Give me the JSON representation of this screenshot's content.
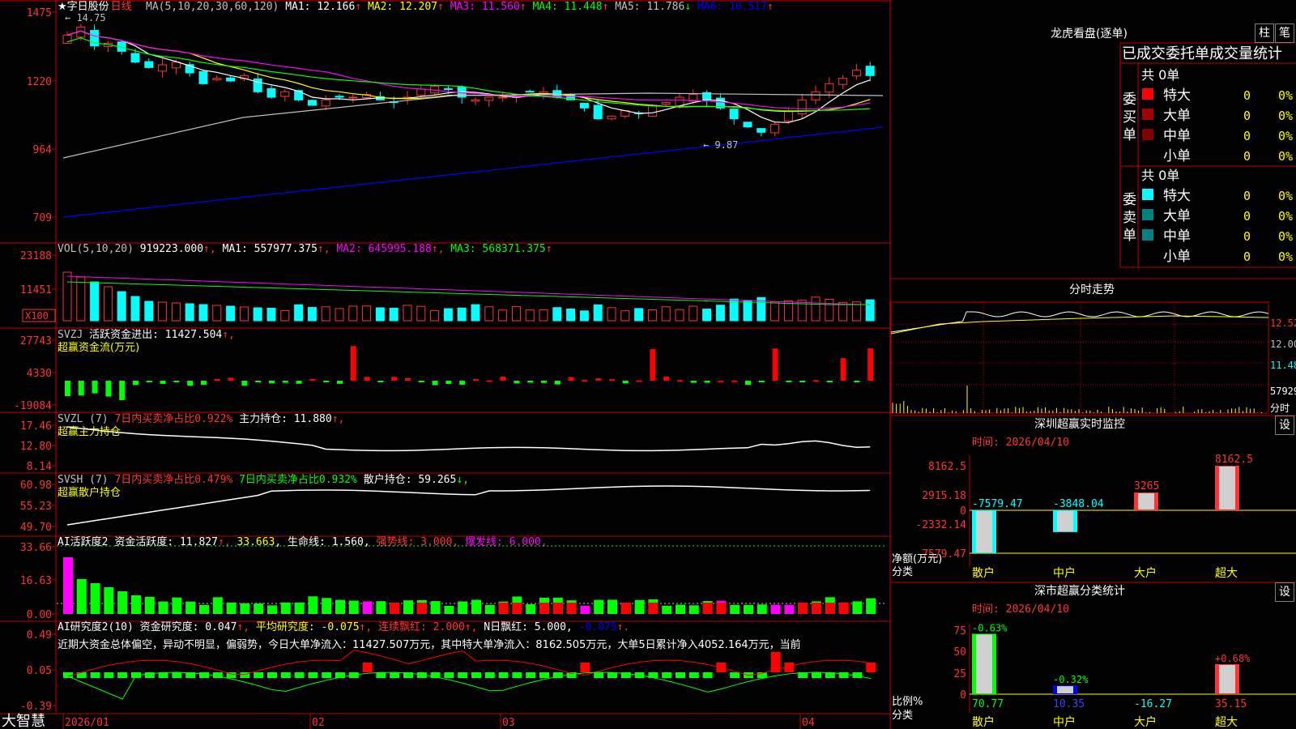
{
  "app": {
    "brand": "大智慧"
  },
  "main": {
    "star": "★",
    "stock_name": "字日股份",
    "period": "日线",
    "ma_label": "MA(5,10,20,30,60,120)",
    "ma": [
      {
        "label": "MA1:",
        "value": "12.166",
        "color": "#ffffff",
        "dir": "↑"
      },
      {
        "label": "MA2:",
        "value": "12.207",
        "color": "#ffff00",
        "dir": "↑"
      },
      {
        "label": "MA3:",
        "value": "11.560",
        "color": "#ff00ff",
        "dir": "↑"
      },
      {
        "label": "MA4:",
        "value": "11.448",
        "color": "#00ff00",
        "dir": "↑"
      },
      {
        "label": "MA5:",
        "value": "11.786",
        "color": "#c0c0c0",
        "dir": "↓"
      },
      {
        "label": "MA6:",
        "value": "10.517",
        "color": "#0000ff",
        "dir": "↑"
      }
    ],
    "y_ticks": [
      "1475",
      "1220",
      "964",
      "709"
    ],
    "high_mark": "14.75",
    "low_mark": "9.87"
  },
  "vol": {
    "label": "VOL(5,10,20)",
    "value": "919223.000",
    "ma1": "557977.375",
    "ma2": "645995.188",
    "ma3": "568371.375",
    "y_ticks": [
      "23188",
      "11451"
    ],
    "unit": "X100"
  },
  "svzj": {
    "label": "SVZJ",
    "desc": "活跃资金进出:",
    "value": "11427.504",
    "subtitle": "超赢资金流(万元)",
    "y_ticks": [
      "27743",
      "4330",
      "-19084"
    ]
  },
  "svzl": {
    "label": "SVZL (7)",
    "ratio_text": "7日内买卖净占比0.922%",
    "hold_label": "主力持仓:",
    "hold_value": "11.880",
    "subtitle": "超赢主力持仓",
    "y_ticks": [
      "17.46",
      "12.80",
      "8.14"
    ]
  },
  "svsh": {
    "label": "SVSH (7)",
    "ratio1": "7日内买卖净占比0.479%",
    "ratio2": "7日内买卖净占比0.932%",
    "hold_label": "散户持仓:",
    "hold_value": "59.265",
    "subtitle": "超赢散户持仓",
    "y_ticks": [
      "60.98",
      "55.23",
      "49.70"
    ]
  },
  "ai1": {
    "label": "AI活跃度2",
    "desc": "资金活跃度:",
    "value": "11.827",
    "v2": "33.663",
    "life": "生命线: 1.560,",
    "strong": "强势线: 3.000,",
    "burst": "爆发线: 6.000,",
    "y_ticks": [
      "33.66",
      "16.63",
      "0.00"
    ]
  },
  "ai2": {
    "label": "AI研究度2(10)",
    "desc": "资金研究度:",
    "value": "0.047",
    "avg": "平均研究度: -0.075",
    "red": "连续飘红: 2.000",
    "nred": "N日飘红: 5.000,",
    "last": "-0.075",
    "scroll_text": "近期大资金总体偏空，异动不明显，偏弱势，今日大单净流入：11427.507万元，其中特大单净流入：8162.505万元，大单5日累计净入4052.164万元，当前",
    "y_ticks": [
      "0.49",
      "0.05",
      "-0.39"
    ]
  },
  "x_axis": [
    "2026/01",
    "02",
    "03",
    "04"
  ],
  "right": {
    "lhb_title": "龙虎看盘(逐单)",
    "btn_zhu": "柱",
    "btn_bi": "笔",
    "headline": "已成交委托单成交量统计",
    "buy_label": "委买单",
    "sell_label": "委卖单",
    "buy_total": "共 0单",
    "sell_total": "共 0单",
    "buy_rows": [
      {
        "name": "特大",
        "n": "0",
        "pct": "0%",
        "color": "#ff0000"
      },
      {
        "name": "大单",
        "n": "0",
        "pct": "0%",
        "color": "#a00000"
      },
      {
        "name": "中单",
        "n": "0",
        "pct": "0%",
        "color": "#800000"
      },
      {
        "name": "小单",
        "n": "0",
        "pct": "0%",
        "color": ""
      }
    ],
    "sell_rows": [
      {
        "name": "特大",
        "n": "0",
        "pct": "0%",
        "color": "#00ffff"
      },
      {
        "name": "大单",
        "n": "0",
        "pct": "0%",
        "color": "#008080"
      },
      {
        "name": "中单",
        "n": "0",
        "pct": "0%",
        "color": "#008080"
      },
      {
        "name": "小单",
        "n": "0",
        "pct": "0%",
        "color": ""
      }
    ],
    "intraday_title": "分时走势",
    "intraday_ticks": [
      "12.52",
      "12.00",
      "11.48",
      "57929",
      "分时"
    ],
    "monitor_title": "深圳超赢实时监控",
    "monitor_btn": "设",
    "monitor_time": "时间: 2026/04/10",
    "monitor_y": [
      "8162.5",
      "2915.18",
      "0",
      "-2332.14",
      "-7579.47"
    ],
    "monitor_bars": [
      {
        "cat": "散户",
        "value": -7579.47,
        "label": "-7579.47"
      },
      {
        "cat": "中户",
        "value": -3848.04,
        "label": "-3848.04"
      },
      {
        "cat": "大户",
        "value": 3265,
        "label": "3265"
      },
      {
        "cat": "超大",
        "value": 8162.5,
        "label": "8162.5"
      }
    ],
    "monitor_ylabel": "净额(万元)",
    "monitor_xlabel": "分类",
    "stat_title": "深市超赢分类统计",
    "stat_btn": "设",
    "stat_time": "时间: 2026/04/10",
    "stat_y": [
      "75",
      "50",
      "25",
      "0"
    ],
    "stat_bars": [
      {
        "cat": "散户",
        "value": 70.77,
        "label": "70.77",
        "chg": "-0.63%"
      },
      {
        "cat": "中户",
        "value": 10.35,
        "label": "10.35",
        "chg": "-0.32%"
      },
      {
        "cat": "大户",
        "value": -16.27,
        "label": "-16.27",
        "chg": ""
      },
      {
        "cat": "超大",
        "value": 35.15,
        "label": "35.15",
        "chg": "+0.68%"
      }
    ],
    "stat_ylabel": "比例%",
    "stat_xlabel": "分类"
  }
}
